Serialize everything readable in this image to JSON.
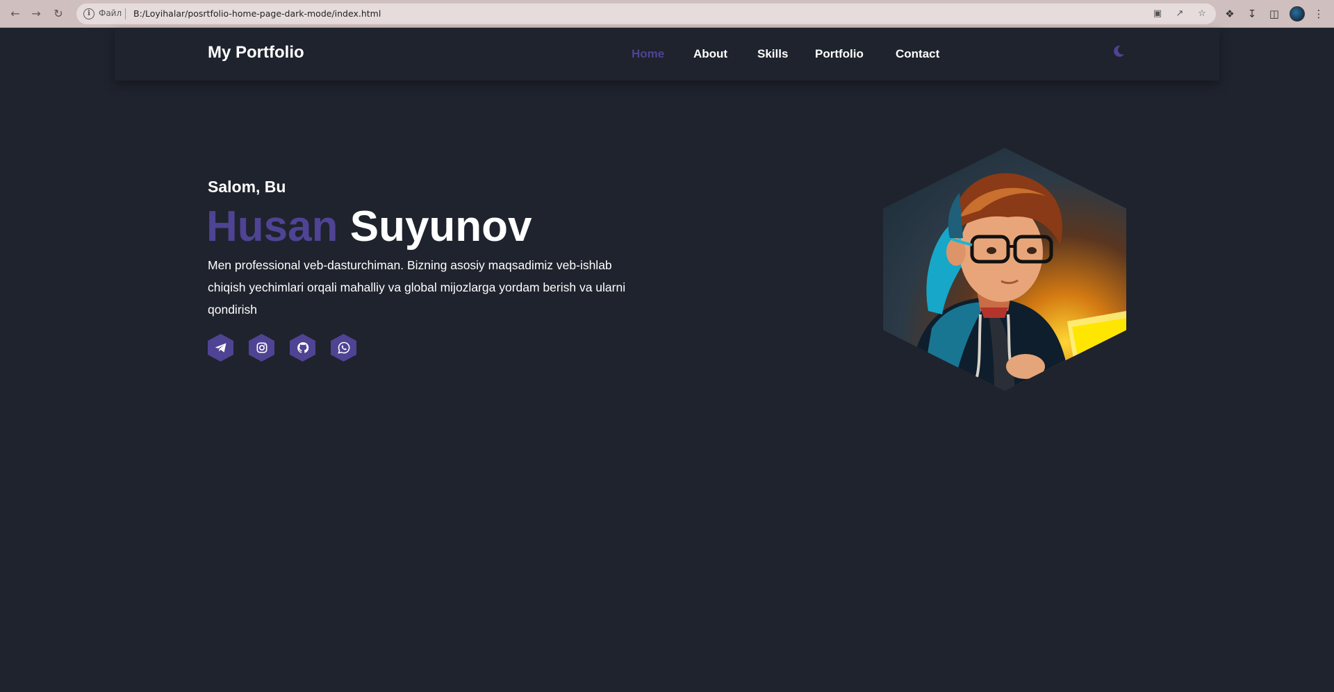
{
  "browser": {
    "url_label": "Файл",
    "url": "B:/Loyihalar/posrtfolio-home-page-dark-mode/index.html"
  },
  "header": {
    "logo": "My Portfolio",
    "nav": [
      {
        "label": "Home",
        "active": true
      },
      {
        "label": "About",
        "active": false
      },
      {
        "label": "Skills",
        "active": false
      },
      {
        "label": "Portfolio",
        "active": false
      },
      {
        "label": "Contact",
        "active": false
      }
    ],
    "theme_icon": "moon-icon"
  },
  "hero": {
    "greeting": "Salom, Bu",
    "first_name": "Husan",
    "last_name": "Suyunov",
    "description": "Men professional veb-dasturchiman. Bizning asosiy maqsadimiz veb-ishlab chiqish yechimlari orqali mahalliy va global mijozlarga yordam berish va ularni qondirish",
    "socials": [
      "telegram-icon",
      "instagram-icon",
      "github-icon",
      "whatsapp-icon"
    ]
  },
  "colors": {
    "accent": "#4f4394",
    "background": "#1f232d",
    "text": "#ffffff"
  }
}
